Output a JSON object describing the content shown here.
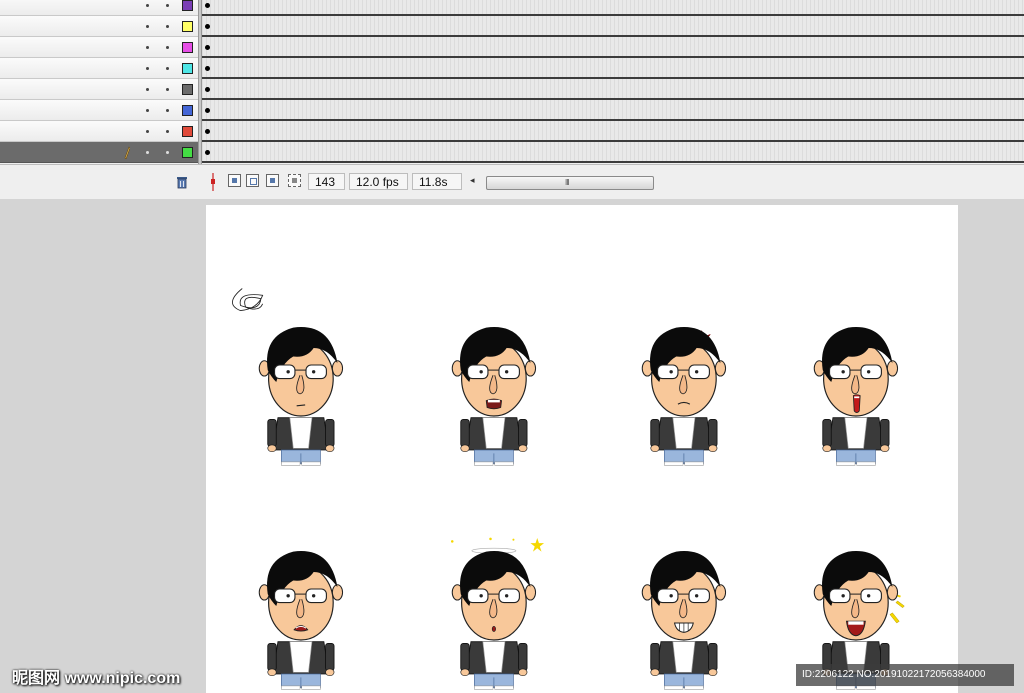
{
  "layers": [
    {
      "color": "#7b3fb6",
      "active": false
    },
    {
      "color": "#ffff66",
      "active": false
    },
    {
      "color": "#e64ee6",
      "active": false
    },
    {
      "color": "#4ee6e6",
      "active": false
    },
    {
      "color": "#6b6b6b",
      "active": false
    },
    {
      "color": "#4466d6",
      "active": false
    },
    {
      "color": "#e04a3a",
      "active": false
    },
    {
      "color": "#44dd44",
      "active": true
    }
  ],
  "status": {
    "frame": "143",
    "fps": "12.0 fps",
    "time": "11.8s",
    "scroll_grip": "III"
  },
  "icons": {
    "trash": "trash-icon",
    "playhead": "playhead-marker-icon",
    "onion1": "onion-skin-icon",
    "onion2": "onion-skin-outlines-icon",
    "edit_multiple": "edit-multiple-frames-icon",
    "modify_markers": "modify-markers-icon"
  },
  "characters": [
    {
      "mouth": "flat",
      "extra": "scribble"
    },
    {
      "mouth": "teeth-open",
      "extra": "none"
    },
    {
      "mouth": "frown",
      "extra": "anger"
    },
    {
      "mouth": "shout-red",
      "extra": "none"
    },
    {
      "mouth": "sad-open",
      "extra": "none"
    },
    {
      "mouth": "small-o",
      "extra": "dizzy"
    },
    {
      "mouth": "grin-teeth",
      "extra": "none"
    },
    {
      "mouth": "laugh",
      "extra": "sparkle"
    }
  ],
  "watermark": {
    "left": "昵图网 www.nipic.com",
    "right": "ID:2206122 NO:20191022172056384000"
  }
}
